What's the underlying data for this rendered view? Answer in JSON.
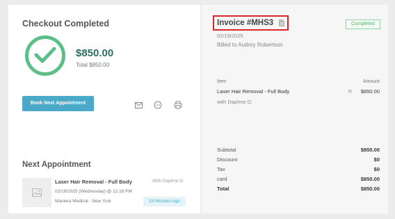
{
  "checkout": {
    "title": "Checkout Completed",
    "amount": "$850.00",
    "total_label": "Total $850.00",
    "book_button": "Book Next Appointment",
    "icons": [
      "mail-icon",
      "chat-icon",
      "print-icon"
    ]
  },
  "next_appointment": {
    "title": "Next Appointment",
    "service": "Laser Hair Removal - Full Body",
    "with": "With Daphne D.",
    "datetime": "02/19/2025 (Wednesday) @ 12:16 PM",
    "location": "Maniera Medical · New York",
    "badge": "33 Minutes Ago"
  },
  "invoice": {
    "title": "Invoice #MHS3",
    "status": "Completed",
    "date": "02/19/2025",
    "billed_to": "Billed to Audrey Robertson",
    "table": {
      "col_item": "Item",
      "col_amount": "Amount",
      "rows": [
        {
          "name": "Laser Hair Removal - Full Body",
          "tax": "tx",
          "amount": "$850.00",
          "with": "with Daphne D."
        }
      ]
    },
    "summary": [
      {
        "label": "Subtotal",
        "value": "$850.00"
      },
      {
        "label": "Discount",
        "value": "$0"
      },
      {
        "label": "Tax",
        "value": "$0"
      },
      {
        "label": "card",
        "value": "$850.00"
      },
      {
        "label": "Total",
        "value": "$850.00"
      }
    ]
  },
  "colors": {
    "accent": "#4aa9c9",
    "success": "#5cbf8a",
    "amount": "#2c6e5d",
    "highlight": "#d9262b"
  }
}
